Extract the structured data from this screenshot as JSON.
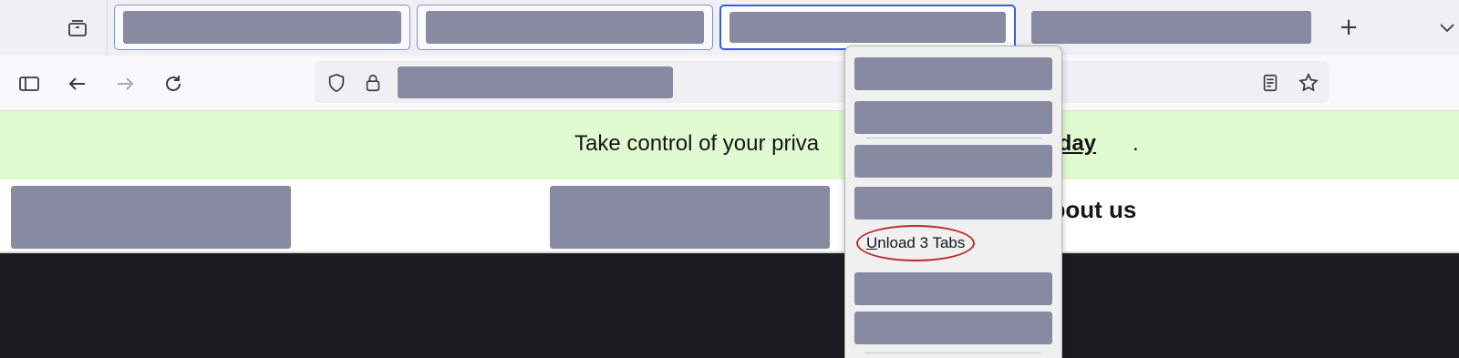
{
  "browser": {
    "tabs": [
      {
        "title": "",
        "state": "multiselected"
      },
      {
        "title": "",
        "state": "multiselected"
      },
      {
        "title": "",
        "state": "selected"
      },
      {
        "title": "",
        "state": "normal"
      }
    ],
    "new_tab_label": "+",
    "address": ""
  },
  "page": {
    "banner": {
      "text": "Take control of your priva",
      "link_text": "today",
      "suffix": "."
    },
    "nav": {
      "about_label": "about us"
    }
  },
  "context_menu": {
    "unload_label": "Unload 3 Tabs",
    "highlight_color": "#c0282d"
  },
  "colors": {
    "banner_bg": "#e0fbd0",
    "selected_tab_border": "#3b5bdb",
    "redaction": "#878aa0"
  }
}
